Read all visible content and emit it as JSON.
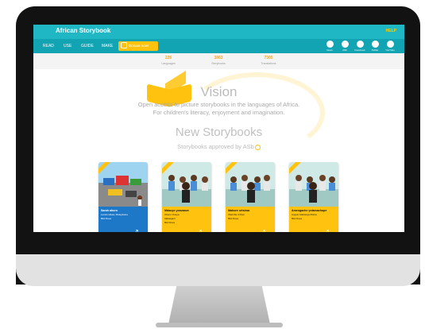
{
  "site": {
    "title": "African Storybook",
    "help": "HELP"
  },
  "nav": {
    "items": [
      "READ",
      "USE",
      "GUIDE",
      "MAKE"
    ],
    "donate": "Donate now!"
  },
  "social": [
    "News",
    "ASb",
    "Facebook",
    "Twitter",
    "YouTube"
  ],
  "stats": [
    {
      "value": "226",
      "label": "Languages"
    },
    {
      "value": "3863",
      "label": "Storybooks"
    },
    {
      "value": "7305",
      "label": "Translations"
    }
  ],
  "vision": {
    "heading": "Vision",
    "line1": "Open access to picture storybooks in the languages of Africa.",
    "line2": "For children's literacy, enjoyment and imagination."
  },
  "new_storybooks": {
    "heading": "New Storybooks",
    "subtitle": "Storybooks approved by ASb"
  },
  "cards": [
    {
      "title": "Sarah ahuro",
      "author": "Lerato Hlasa, Mulepitsina",
      "publisher": "Bird Dues",
      "color": "#1e78c8"
    },
    {
      "title": "Mdauyo yonzanze",
      "author": "Otieno Onaya",
      "illustrator": "Mdawgazi",
      "publisher": "Bird Dues",
      "color": "#ffc20e"
    },
    {
      "title": "Mahore ortsiroa",
      "author": "Olamiba 4 Mum",
      "publisher": "Bird Dues",
      "color": "#ffc20e"
    },
    {
      "title": "Amengache yolamachupe",
      "author": "Angelo Mabanga Muina",
      "publisher": "Bird Dues",
      "color": "#ffc20e"
    }
  ]
}
